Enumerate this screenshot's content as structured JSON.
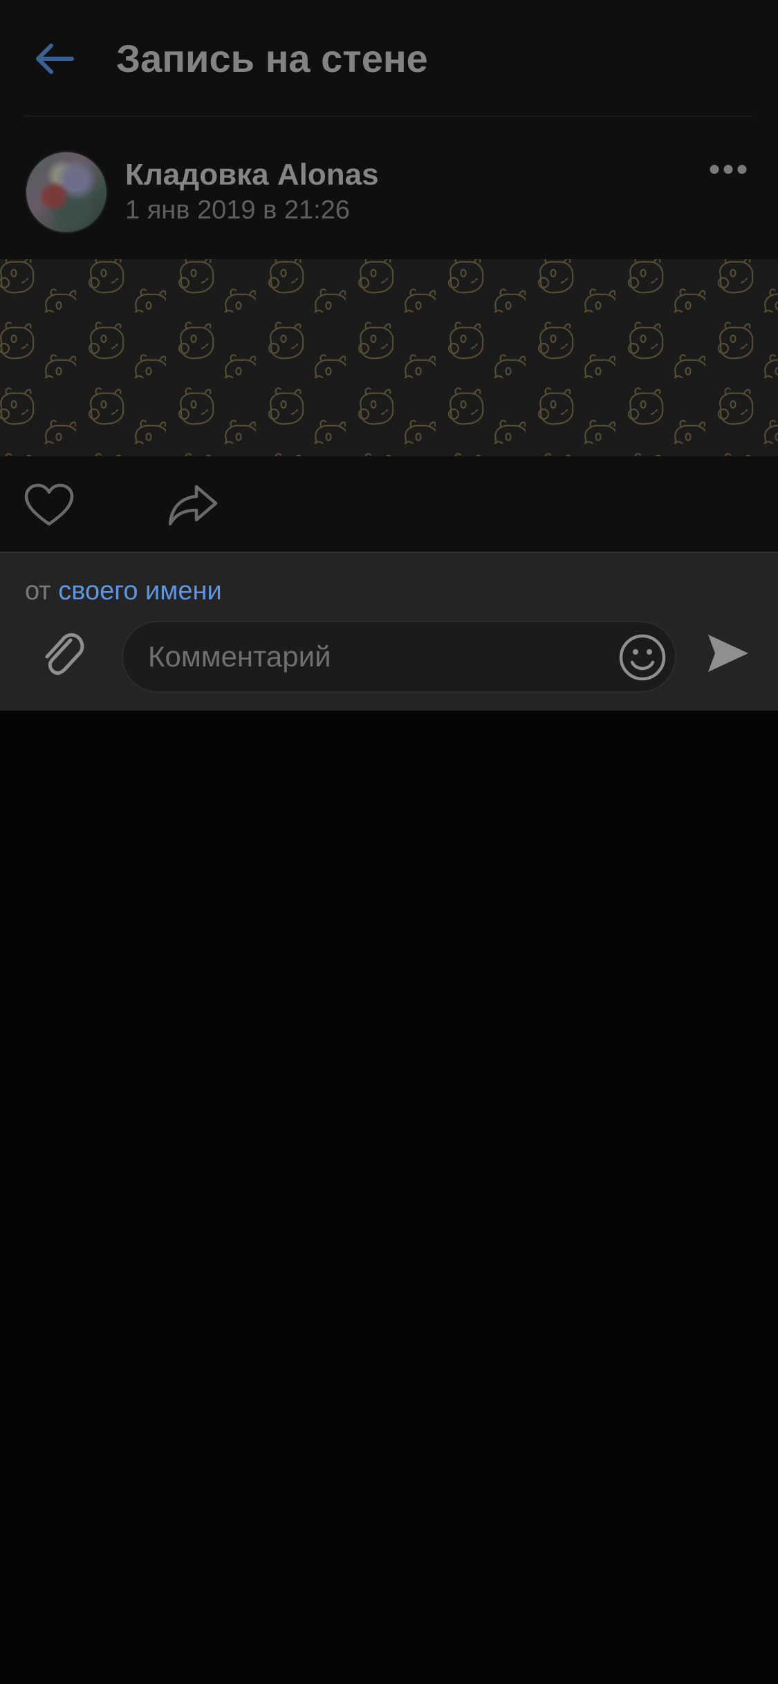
{
  "header": {
    "title": "Запись на стене",
    "back_icon": "arrow-left-icon",
    "accent_color": "#4a78b0"
  },
  "post": {
    "author_name": "Кладовка Alonas",
    "date": "1 янв 2019 в 21:26",
    "more_icon": "more-horizontal-icon",
    "image_pattern": "bear-head-doodle-pattern",
    "pattern_color": "#5a5036"
  },
  "actions": {
    "like_icon": "heart-outline-icon",
    "share_icon": "share-arrow-icon"
  },
  "composer": {
    "from_prefix": "от",
    "from_link": "своего имени",
    "link_color": "#5e97e0",
    "placeholder": "Комментарий",
    "attach_icon": "paperclip-icon",
    "emoji_icon": "smile-icon",
    "send_icon": "send-icon"
  }
}
